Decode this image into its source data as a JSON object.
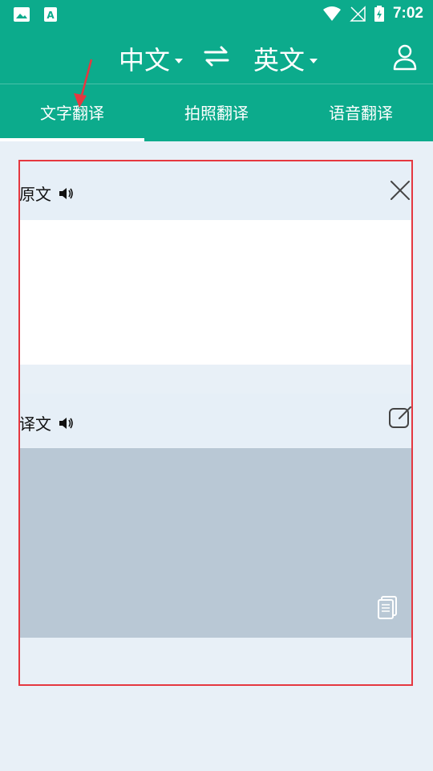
{
  "status": {
    "time": "7:02"
  },
  "languages": {
    "source": "中文",
    "target": "英文"
  },
  "tabs": [
    {
      "label": "文字翻译",
      "active": true
    },
    {
      "label": "拍照翻译",
      "active": false
    },
    {
      "label": "语音翻译",
      "active": false
    }
  ],
  "source_panel": {
    "label": "原文",
    "input_value": ""
  },
  "target_panel": {
    "label": "译文",
    "output_value": ""
  },
  "colors": {
    "primary": "#0cab8c",
    "background": "#e8f0f7",
    "output_bg": "#b9c8d5",
    "annotation": "#e53840"
  },
  "icons": {
    "status_left": [
      "gallery-icon",
      "font-app-icon"
    ],
    "status_right": [
      "wifi-icon",
      "signal-off-icon",
      "battery-charging-icon"
    ],
    "swap": "swap-icon",
    "user": "user-icon",
    "speaker": "speaker-icon",
    "clear": "close-icon",
    "edit": "edit-icon",
    "copy": "copy-icon"
  }
}
